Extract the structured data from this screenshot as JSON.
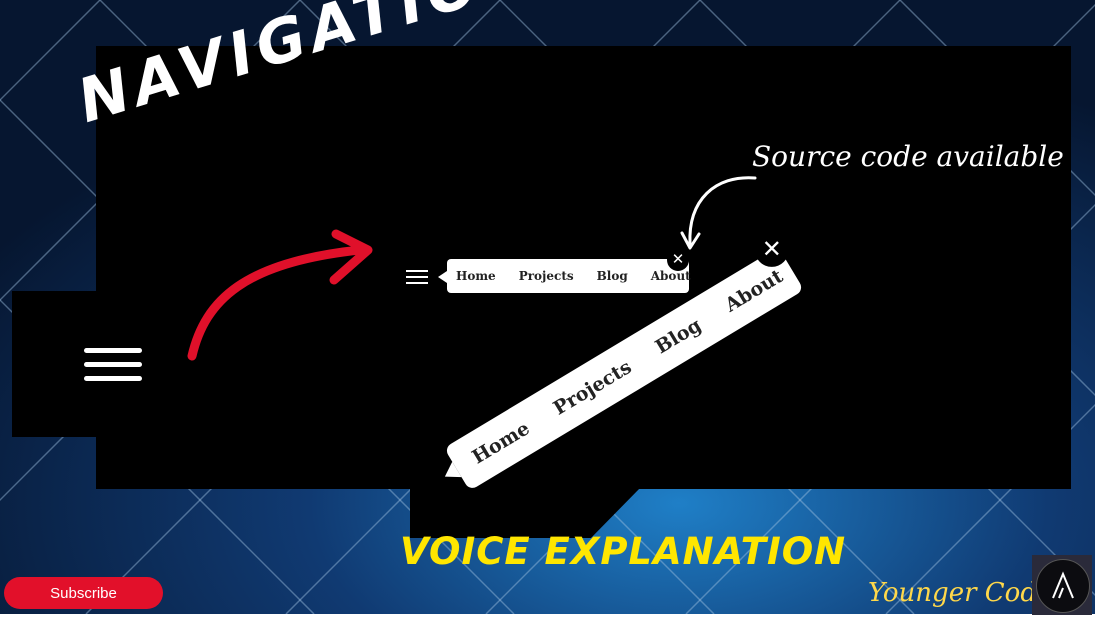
{
  "title": "NAVIGATION BAR",
  "note": "Source code available",
  "nav_links": [
    "Home",
    "Projects",
    "Blog",
    "About"
  ],
  "close_glyph": "✕",
  "voice_label": "VOICE EXPLANATION",
  "subscribe_label": "Subscribe",
  "brand": "Younger Coding",
  "colors": {
    "background": "#0d2a57",
    "panel": "#000000",
    "arrow": "#e0102a",
    "voice": "#ffe600",
    "brand": "#ffd84a",
    "subscribe": "#e2102a"
  },
  "icons": {
    "menu": "hamburger-icon",
    "close": "close-icon",
    "logo": "channel-logo-icon"
  }
}
